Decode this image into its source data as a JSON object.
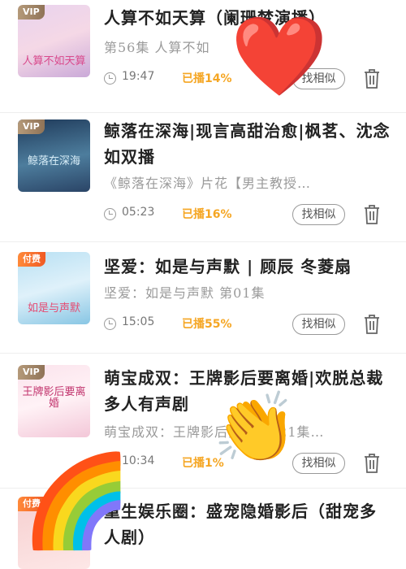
{
  "items": [
    {
      "badge": "VIP",
      "cover_text": "人算不如天算",
      "title": "人算不如天算（阑珊梦演播）",
      "subtitle": "第56集 人算不如",
      "duration": "19:47",
      "played": "已播14%",
      "similar_label": "找相似"
    },
    {
      "badge": "VIP",
      "cover_text": "鲸落在深海",
      "title": "鲸落在深海|现言高甜治愈|枫茗、沈念如双播",
      "subtitle": "《鲸落在深海》片花【男主教授…",
      "duration": "05:23",
      "played": "已播16%",
      "similar_label": "找相似"
    },
    {
      "badge": "付费",
      "cover_text": "如是与声默",
      "title": "坚爱：如是与声默 | 顾辰 冬菱扇",
      "subtitle": "坚爱：如是与声默 第01集",
      "duration": "15:05",
      "played": "已播55%",
      "similar_label": "找相似"
    },
    {
      "badge": "VIP",
      "cover_text": "王牌影后要离婚",
      "title": "萌宝成双：王牌影后要离婚|欢脱总裁多人有声剧",
      "subtitle": "萌宝成双：王牌影后要离婚121集…",
      "duration": "10:34",
      "played": "已播1%",
      "similar_label": "找相似"
    },
    {
      "badge": "付费",
      "cover_text": "",
      "title": "重生娱乐圈：盛宠隐婚影后（甜宠多人剧）",
      "subtitle": "",
      "duration": "",
      "played": "",
      "similar_label": ""
    }
  ],
  "stickers": {
    "heart": "❤️",
    "clap": "👏",
    "rainbow": "🌈"
  }
}
